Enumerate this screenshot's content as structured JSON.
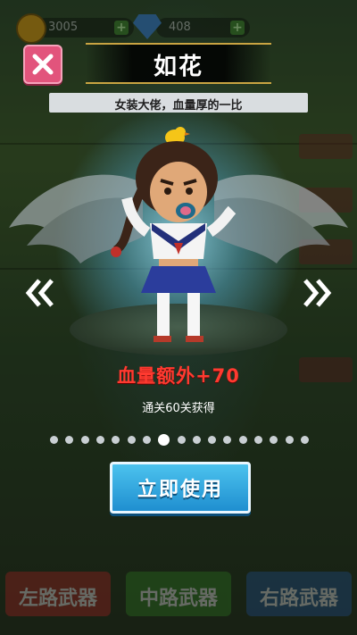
{
  "resources": {
    "gold": "3005",
    "gems": "408",
    "plus_label": "+"
  },
  "skin": {
    "name": "如花",
    "description": "女装大佬，血量厚的一比",
    "reward": "血量额外+70",
    "unlock_condition": "通关60关获得"
  },
  "pager": {
    "total": 17,
    "active_index": 7
  },
  "actions": {
    "use_label": "立即使用"
  },
  "background_buttons": {
    "left": "左路武器",
    "middle": "中路武器",
    "right": "右路武器"
  },
  "colors": {
    "close": "#e2547c",
    "reward": "#ff3a30",
    "use_button": "#2a9fdc"
  }
}
